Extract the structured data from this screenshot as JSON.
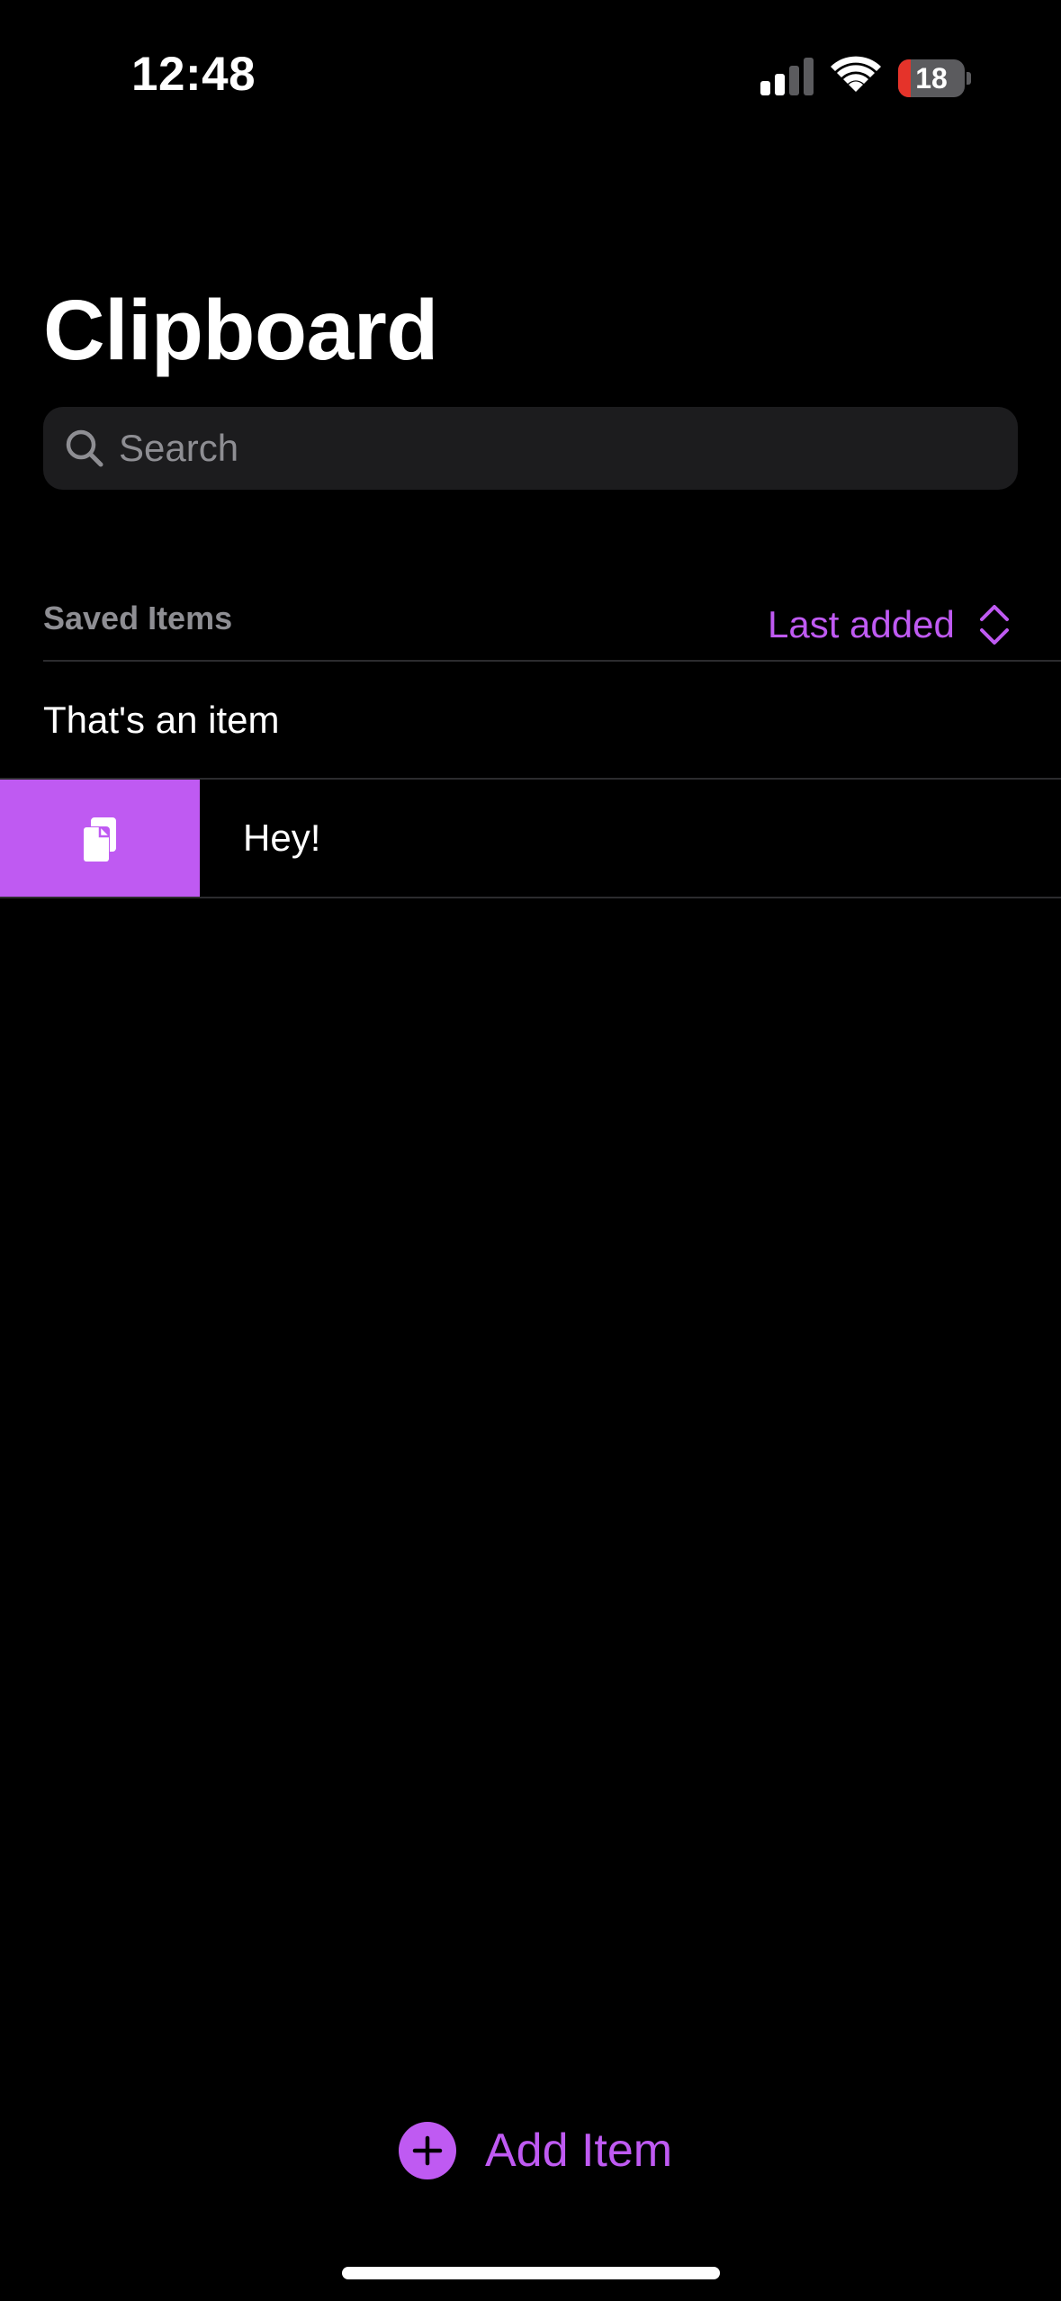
{
  "status_bar": {
    "time": "12:48",
    "battery_level": "18",
    "battery_color": "#e5332a",
    "signal_bars_active": 2,
    "signal_bars_total": 4
  },
  "header": {
    "title": "Clipboard"
  },
  "search": {
    "placeholder": "Search",
    "value": ""
  },
  "section": {
    "title": "Saved Items",
    "sort_label": "Last added"
  },
  "items": [
    {
      "text": "That's an item"
    },
    {
      "text": "Hey!",
      "swipe_action_icon": "copy-icon"
    }
  ],
  "footer": {
    "add_label": "Add Item"
  },
  "colors": {
    "accent": "#bf5af2",
    "background": "#000000",
    "search_bg": "#1c1c1e",
    "secondary_text": "#8e8e93"
  }
}
